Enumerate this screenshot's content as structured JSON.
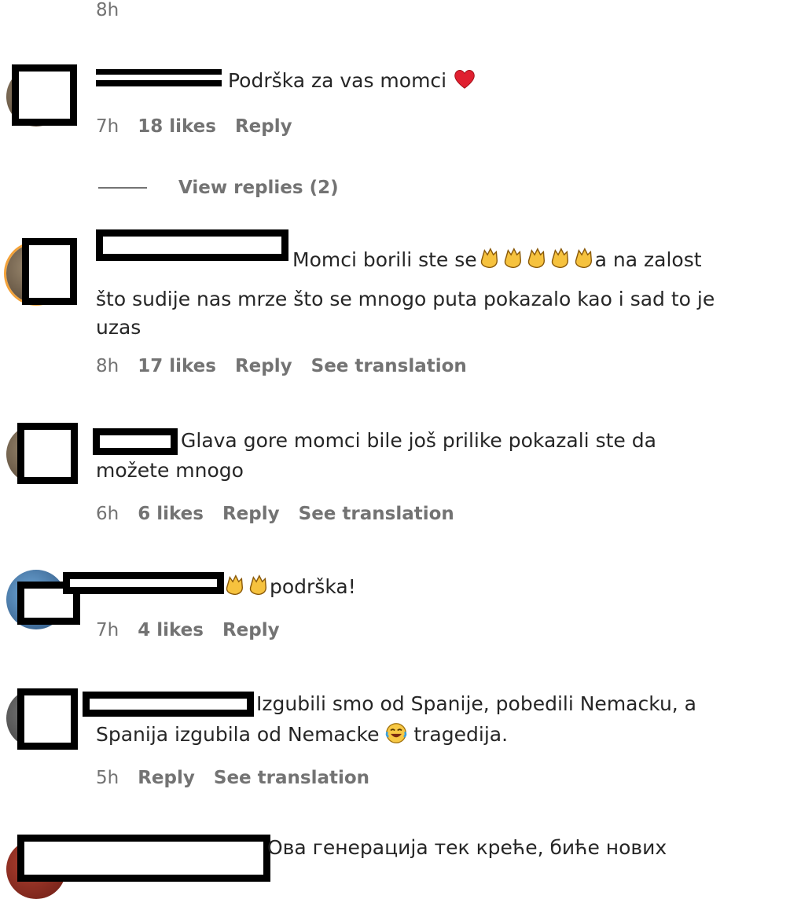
{
  "top": {
    "time": "8h"
  },
  "comments": [
    {
      "text": " Podrška za vas momci ",
      "emoji": "heart",
      "time": "7h",
      "likes": "18 likes",
      "reply": "Reply",
      "view_replies": "View replies (2)"
    },
    {
      "line1": " Momci borili ste se",
      "line1_end": "a na zalost",
      "line2": "što sudije nas mrze što se mnogo puta pokazalo kao i sad to je",
      "line3": "uzas",
      "time": "8h",
      "likes": "17 likes",
      "reply": "Reply",
      "translate": "See translation"
    },
    {
      "line1": "Glava gore momci bile još prilike pokazali ste da",
      "line2": "možete mnogo",
      "time": "6h",
      "likes": "6 likes",
      "reply": "Reply",
      "translate": "See translation"
    },
    {
      "line1": "podrška!",
      "time": "7h",
      "likes": "4 likes",
      "reply": "Reply"
    },
    {
      "line1": "Izgubili smo od Spanije, pobedili Nemacku, a",
      "line2a": "Spanija izgubila od Nemacke ",
      "line2b": " tragedija.",
      "time": "5h",
      "reply": "Reply",
      "translate": "See translation"
    },
    {
      "line1": "Ова генерација тек креће, биће нових"
    }
  ],
  "icons": {
    "clap": "clapping-hands-icon",
    "heart": "red-heart-icon",
    "laugh": "face-with-tears-of-joy-icon"
  }
}
